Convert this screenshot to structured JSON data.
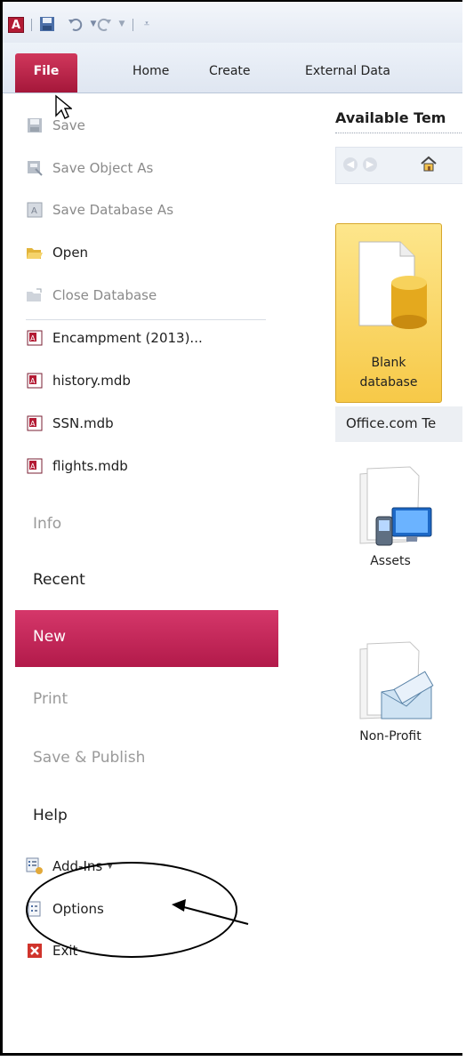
{
  "qat": {
    "app_icon_letter": "A",
    "icons": [
      "save-icon",
      "undo-icon",
      "redo-icon",
      "customize-icon"
    ]
  },
  "tabs": {
    "file": "File",
    "home": "Home",
    "create": "Create",
    "external_data": "External Data"
  },
  "commands": {
    "save": "Save",
    "save_object_as": "Save Object As",
    "save_database_as": "Save Database As",
    "open": "Open",
    "close_database": "Close Database"
  },
  "recent_files": [
    "Encampment (2013)...",
    "history.mdb",
    "SSN.mdb",
    "flights.mdb"
  ],
  "sections": {
    "info": "Info",
    "recent": "Recent",
    "new": "New",
    "print": "Print",
    "save_publish": "Save & Publish",
    "help": "Help"
  },
  "bottom": {
    "add_ins": "Add-Ins",
    "options": "Options",
    "exit": "Exit"
  },
  "main": {
    "title": "Available Tem",
    "blank_line1": "Blank",
    "blank_line2": "database",
    "office_band": "Office.com Te",
    "templates": [
      "Assets",
      "Non-Profit"
    ]
  },
  "colors": {
    "accent": "#b7194a",
    "file_tab": "#c62a50",
    "disabled_text": "#8a8a8a"
  }
}
